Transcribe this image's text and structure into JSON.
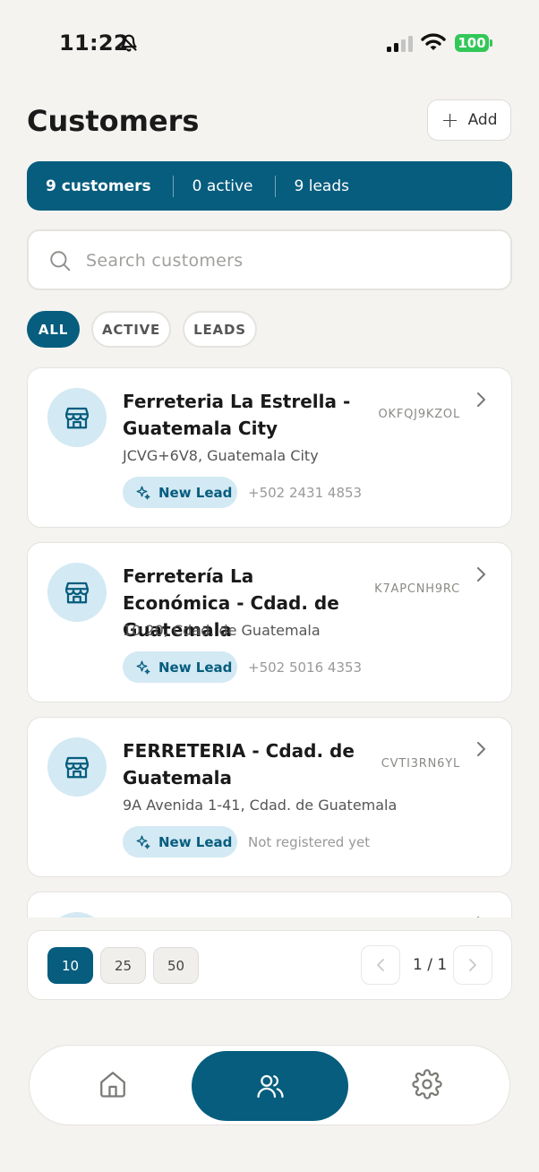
{
  "status_bar": {
    "time": "11:22",
    "battery": "100"
  },
  "header": {
    "title": "Customers",
    "add_label": "Add"
  },
  "stats": {
    "customers": "9 customers",
    "active": "0 active",
    "leads": "9 leads"
  },
  "search": {
    "placeholder": "Search customers"
  },
  "filters": [
    {
      "label": "ALL",
      "selected": true
    },
    {
      "label": "ACTIVE",
      "selected": false
    },
    {
      "label": "LEADS",
      "selected": false
    }
  ],
  "customers": [
    {
      "name": "Ferreteria La Estrella - Guatemala City",
      "code": "OKFQJ9KZOL",
      "address": "JCVG+6V8, Guatemala City",
      "badge": "New Lead",
      "phone": "+502 2431 4853"
    },
    {
      "name": "Ferretería La Económica - Cdad. de Guatemala",
      "code": "K7APCNH9RC",
      "address": "10 20, Cdad. de Guatemala",
      "badge": "New Lead",
      "phone": "+502 5016 4353"
    },
    {
      "name": "FERRETERIA - Cdad. de Guatemala",
      "code": "CVTI3RN6YL",
      "address": "9A Avenida 1-41, Cdad. de Guatemala",
      "badge": "New Lead",
      "phone": "Not registered yet"
    }
  ],
  "pagination": {
    "sizes": [
      "10",
      "25",
      "50"
    ],
    "selected_size": "10",
    "page_info": "1 / 1"
  },
  "colors": {
    "primary": "#065d7e",
    "badge_bg": "#d3e9f3",
    "background": "#f4f3f0",
    "battery": "#33c759"
  },
  "icons": {
    "add": "plus-icon",
    "search": "search-icon",
    "store": "store-icon",
    "badge": "sparkles-icon",
    "nav": [
      "home-icon",
      "users-icon",
      "gear-icon"
    ]
  }
}
